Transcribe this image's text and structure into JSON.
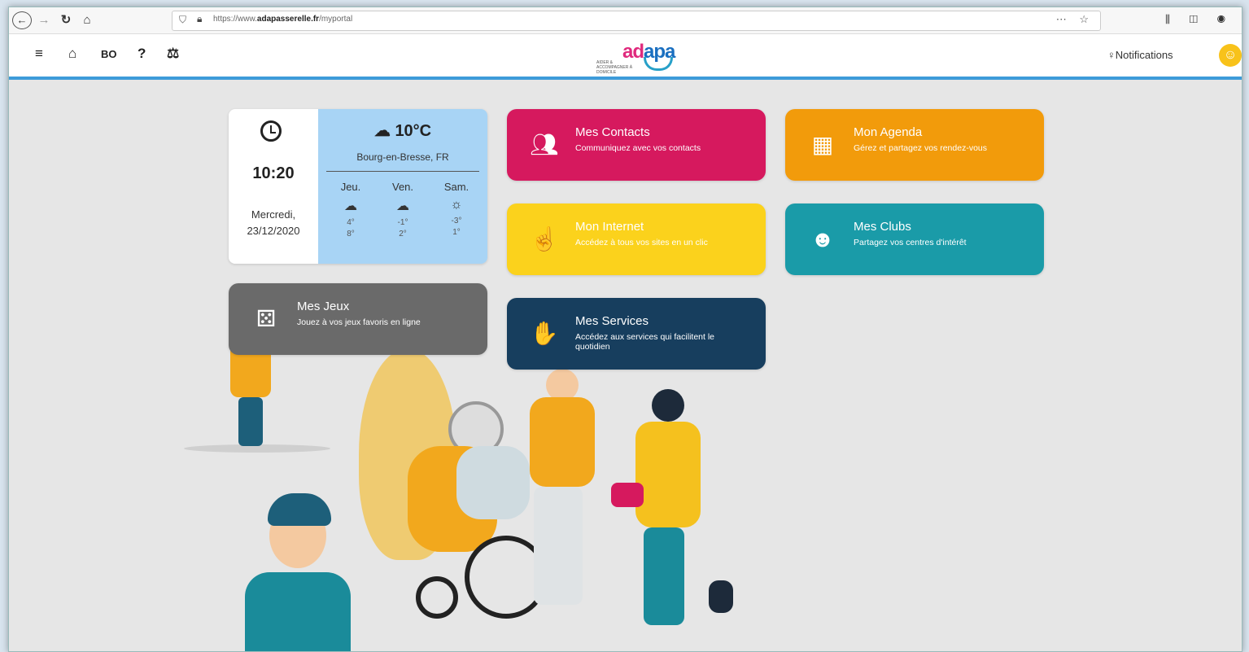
{
  "browser": {
    "url_prefix": "https://www.",
    "url_domain": "adapasserelle.fr",
    "url_path": "/myportal"
  },
  "header": {
    "bo_label": "BO",
    "help_label": "?",
    "logo_text_a": "ad",
    "logo_text_b": "apa",
    "logo_sub": "AIDER & ACCOMPAGNER À DOMICILE",
    "notifications_label": "Notifications"
  },
  "clock": {
    "time": "10:20",
    "day": "Mercredi,",
    "date": "23/12/2020"
  },
  "weather": {
    "temp": "10°C",
    "city": "Bourg-en-Bresse, FR",
    "forecast": [
      {
        "day": "Jeu.",
        "min": "4°",
        "max": "8°",
        "icon": "rain-cloud-icon"
      },
      {
        "day": "Ven.",
        "min": "-1°",
        "max": "2°",
        "icon": "rain-cloud-icon"
      },
      {
        "day": "Sam.",
        "min": "-3°",
        "max": "1°",
        "icon": "sun-snow-icon"
      }
    ]
  },
  "tiles": {
    "contacts": {
      "title": "Mes Contacts",
      "sub": "Communiquez avec vos contacts",
      "color": "#d6195e"
    },
    "agenda": {
      "title": "Mon Agenda",
      "sub": "Gérez et partagez vos rendez-vous",
      "color": "#f29b0b"
    },
    "internet": {
      "title": "Mon Internet",
      "sub": "Accédez à tous vos sites en un clic",
      "color": "#fbd21c"
    },
    "clubs": {
      "title": "Mes Clubs",
      "sub": "Partagez vos centres d'intérêt",
      "color": "#1a9ba8"
    },
    "jeux": {
      "title": "Mes Jeux",
      "sub": "Jouez à vos jeux favoris en ligne",
      "color": "#6a6a6a"
    },
    "services": {
      "title": "Mes Services",
      "sub": "Accédez aux services qui facilitent le quotidien",
      "color": "#173e5e"
    }
  }
}
